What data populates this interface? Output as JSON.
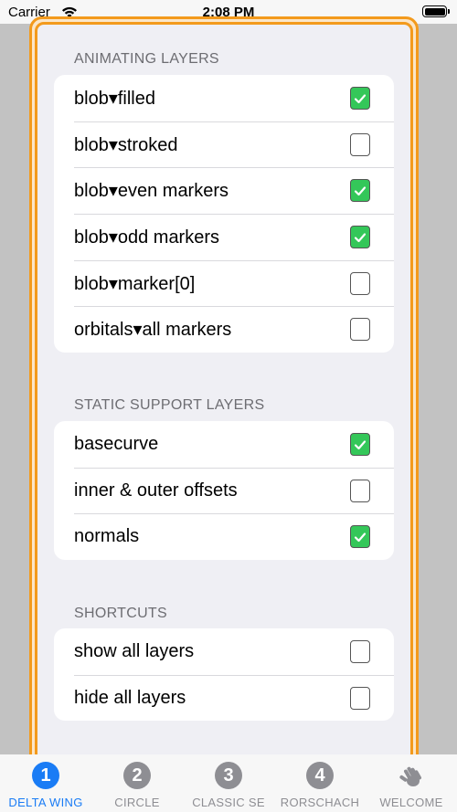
{
  "status_bar": {
    "carrier": "Carrier",
    "time": "2:08 PM"
  },
  "sections": [
    {
      "header": "ANIMATING LAYERS",
      "rows": [
        {
          "label": "blob▾filled",
          "checked": true
        },
        {
          "label": "blob▾stroked",
          "checked": false
        },
        {
          "label": "blob▾even markers",
          "checked": true
        },
        {
          "label": "blob▾odd markers",
          "checked": true
        },
        {
          "label": "blob▾marker[0]",
          "checked": false
        },
        {
          "label": "orbitals▾all markers",
          "checked": false
        }
      ]
    },
    {
      "header": "STATIC SUPPORT LAYERS",
      "rows": [
        {
          "label": "basecurve",
          "checked": true
        },
        {
          "label": "inner & outer offsets",
          "checked": false
        },
        {
          "label": "normals",
          "checked": true
        }
      ]
    },
    {
      "header": "SHORTCUTS",
      "rows": [
        {
          "label": "show all layers",
          "checked": false
        },
        {
          "label": "hide all layers",
          "checked": false
        }
      ]
    }
  ],
  "tabs": [
    {
      "number": "1",
      "label": "DELTA WING",
      "active": true
    },
    {
      "number": "2",
      "label": "CIRCLE",
      "active": false
    },
    {
      "number": "3",
      "label": "CLASSIC SE",
      "active": false
    },
    {
      "number": "4",
      "label": "RORSCHACH",
      "active": false
    },
    {
      "number": "",
      "icon": "hand-wave-icon",
      "label": "WELCOME",
      "active": false
    }
  ],
  "colors": {
    "accent": "#1a7cf5",
    "check_green": "#34c759",
    "frame_orange": "#f39a1c"
  }
}
